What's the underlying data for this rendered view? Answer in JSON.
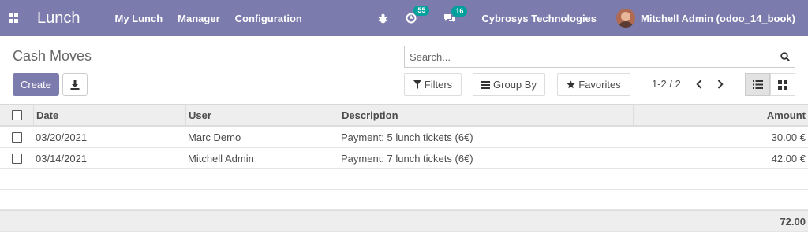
{
  "navbar": {
    "app_title": "Lunch",
    "menu": [
      "My Lunch",
      "Manager",
      "Configuration"
    ],
    "activity_count": "55",
    "message_count": "16",
    "company": "Cybrosys Technologies",
    "user": "Mitchell Admin (odoo_14_book)",
    "bg_color": "#7c7bad"
  },
  "control_panel": {
    "breadcrumb": "Cash Moves",
    "search_placeholder": "Search...",
    "create_label": "Create",
    "filters_label": "Filters",
    "groupby_label": "Group By",
    "favorites_label": "Favorites",
    "pager": "1-2 / 2"
  },
  "table": {
    "columns": {
      "date": "Date",
      "user": "User",
      "description": "Description",
      "amount": "Amount"
    },
    "rows": [
      {
        "date": "03/20/2021",
        "user": "Marc Demo",
        "description": "Payment: 5 lunch tickets (6€)",
        "amount": "30.00 €"
      },
      {
        "date": "03/14/2021",
        "user": "Mitchell Admin",
        "description": "Payment: 7 lunch tickets (6€)",
        "amount": "42.00 €"
      }
    ],
    "total": "72.00"
  },
  "icons": [
    "apps-grid-icon",
    "bug-icon",
    "activity-clock-icon",
    "chat-icon",
    "download-icon",
    "search-icon",
    "filter-icon",
    "group-by-icon",
    "star-icon",
    "chevron-left-icon",
    "chevron-right-icon",
    "list-view-icon",
    "kanban-view-icon"
  ]
}
